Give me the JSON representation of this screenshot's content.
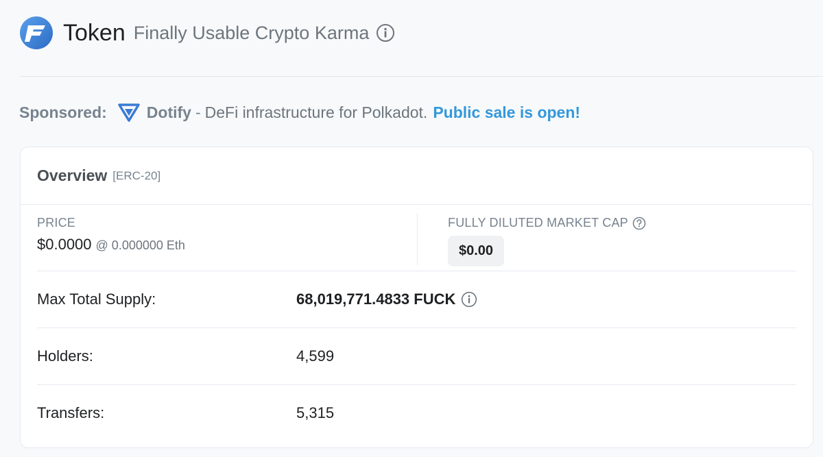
{
  "header": {
    "title": "Token",
    "token_name": "Finally Usable Crypto Karma",
    "logo_icon": "token-logo-icon",
    "info_icon": "info-icon"
  },
  "sponsored": {
    "label": "Sponsored:",
    "brand": "Dotify",
    "dash": "-",
    "description": "DeFi infrastructure for Polkadot.",
    "link_text": "Public sale is open!",
    "link_color": "#3498db"
  },
  "overview": {
    "title": "Overview",
    "standard": "[ERC-20]",
    "price": {
      "caption": "PRICE",
      "value": "$0.0000",
      "eth": "@ 0.000000 Eth"
    },
    "market_cap": {
      "caption": "FULLY DILUTED MARKET CAP",
      "value": "$0.00"
    },
    "rows": [
      {
        "label": "Max Total Supply:",
        "value": "68,019,771.4833 FUCK"
      },
      {
        "label": "Holders:",
        "value": "4,599"
      },
      {
        "label": "Transfers:",
        "value": "5,315"
      }
    ]
  },
  "colors": {
    "accent": "#3498db",
    "logo_blue": "#3a7bd5",
    "muted": "#77838f"
  }
}
